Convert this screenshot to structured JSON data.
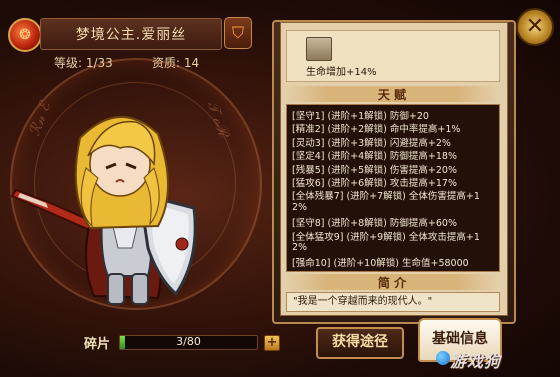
{
  "header": {
    "title": "梦境公主.爱丽丝",
    "level_label": "等级: 1/33",
    "quality_label": "资质: 14",
    "emblem_icon": "phoenix-emblem-icon",
    "shield_icon": "shield-icon"
  },
  "shards": {
    "label": "碎片",
    "current": 3,
    "max": 80,
    "text": "3/80",
    "fill_fraction": 0.04,
    "add_label": "+"
  },
  "panel": {
    "item_effect": "生命增加+14%",
    "talent_heading": "天 赋",
    "talents": [
      "[坚守1] (进阶+1解锁) 防御+20",
      "[精准2] (进阶+2解锁) 命中率提高+1%",
      "[灵动3] (进阶+3解锁) 闪避提高+2%",
      "[坚定4] (进阶+4解锁) 防御提高+18%",
      "[残暴5] (进阶+5解锁) 伤害提高+20%",
      "[猛攻6] (进阶+6解锁) 攻击提高+17%",
      "[全体残暴7] (进阶+7解锁) 全体伤害提高+1",
      "2%",
      "[坚守8] (进阶+8解锁) 防御提高+60%",
      "[全体猛攻9] (进阶+9解锁) 全体攻击提高+1",
      "2%",
      "[强命10] (进阶+10解锁) 生命值+58000"
    ],
    "intro_heading": "简 介",
    "intro_quote": "\"我是一个穿越而来的现代人。\""
  },
  "buttons": {
    "obtain": "获得途径",
    "basic_info": "基础信息",
    "close": "✕"
  },
  "watermark": "游戏狗",
  "colors": {
    "accent_gold": "#c28d4d",
    "bar_green": "#4fbf2e",
    "talent_bg": "#231109"
  }
}
